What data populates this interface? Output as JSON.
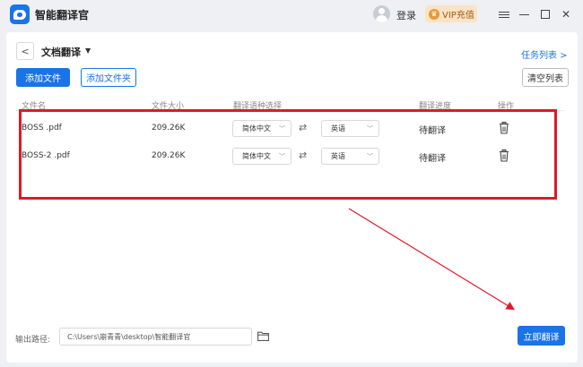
{
  "app": {
    "title": "智能翻译官",
    "icon": "app-logo-icon"
  },
  "header": {
    "login_label": "登录",
    "vip_label": "VIP充值",
    "vip_icon": "vip-crown-icon"
  },
  "page": {
    "title": "文档翻译",
    "task_list_link": "任务列表 >",
    "add_file_label": "添加文件",
    "add_folder_label": "添加文件夹",
    "clear_list_label": "清空列表"
  },
  "table": {
    "columns": [
      "文件名",
      "文件大小",
      "翻译语种选择",
      "翻译进度",
      "操作"
    ],
    "rows": [
      {
        "name": "BOSS .pdf",
        "size": "209.26K",
        "source_lang": "简体中文",
        "target_lang": "英语",
        "status": "待翻译"
      },
      {
        "name": "BOSS-2 .pdf",
        "size": "209.26K",
        "source_lang": "简体中文",
        "target_lang": "英语",
        "status": "待翻译"
      }
    ]
  },
  "footer": {
    "output_label": "输出路径:",
    "output_path": "C:\\Users\\崩青青\\desktop\\智能翻译官",
    "start_label": "立即翻译"
  },
  "colors": {
    "accent": "#1a73e8",
    "annotation": "#e0182a",
    "vip_bg": "#fbe3c4"
  }
}
